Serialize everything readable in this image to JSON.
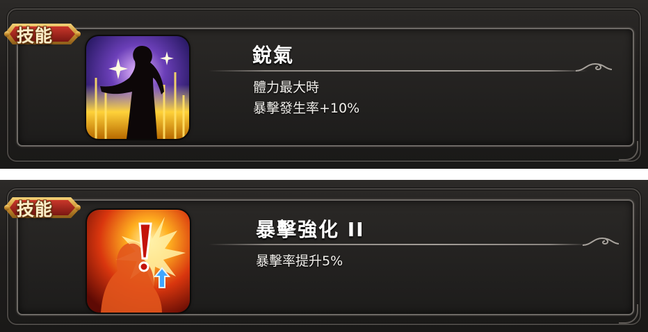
{
  "skills": [
    {
      "badge": "技能",
      "name": "銳氣",
      "icon": "silhouette-aura-icon",
      "description": [
        "體力最大時",
        "暴擊發生率+10%"
      ]
    },
    {
      "badge": "技能",
      "name": "暴擊強化 II",
      "icon": "critical-strike-up-icon",
      "description": [
        "暴擊率提升5%"
      ]
    }
  ],
  "colors": {
    "panel_bg": "#1f1d1c",
    "frame": "#6e6a66",
    "badge_gold": "#d9a441",
    "badge_red": "#a3241b",
    "text": "#ffffff"
  }
}
